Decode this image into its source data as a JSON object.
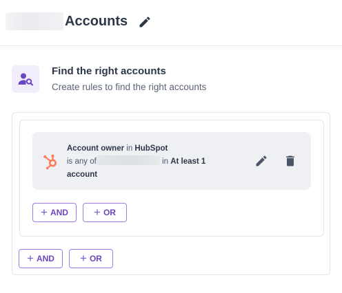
{
  "header": {
    "title": "Accounts",
    "edit_icon": "pencil-icon"
  },
  "section": {
    "icon": "user-search-icon",
    "title": "Find the right accounts",
    "subtitle": "Create rules to find the right accounts"
  },
  "rule": {
    "icon": "hubspot-icon",
    "field": "Account owner",
    "in_word": "in",
    "source": "HubSpot",
    "operator": "is any of",
    "in_word_2": "in",
    "quantifier": "At least 1",
    "quantifier_unit": "account",
    "edit_icon": "pencil-icon",
    "delete_icon": "trash-icon"
  },
  "inner_group": {
    "and_label": "AND",
    "or_label": "OR"
  },
  "outer_group": {
    "and_label": "AND",
    "or_label": "OR"
  },
  "colors": {
    "accent": "#6b46c1",
    "hubspot": "#ff7a59",
    "icon_dark": "#2d3748",
    "icon_bg": "#f1edfb"
  }
}
